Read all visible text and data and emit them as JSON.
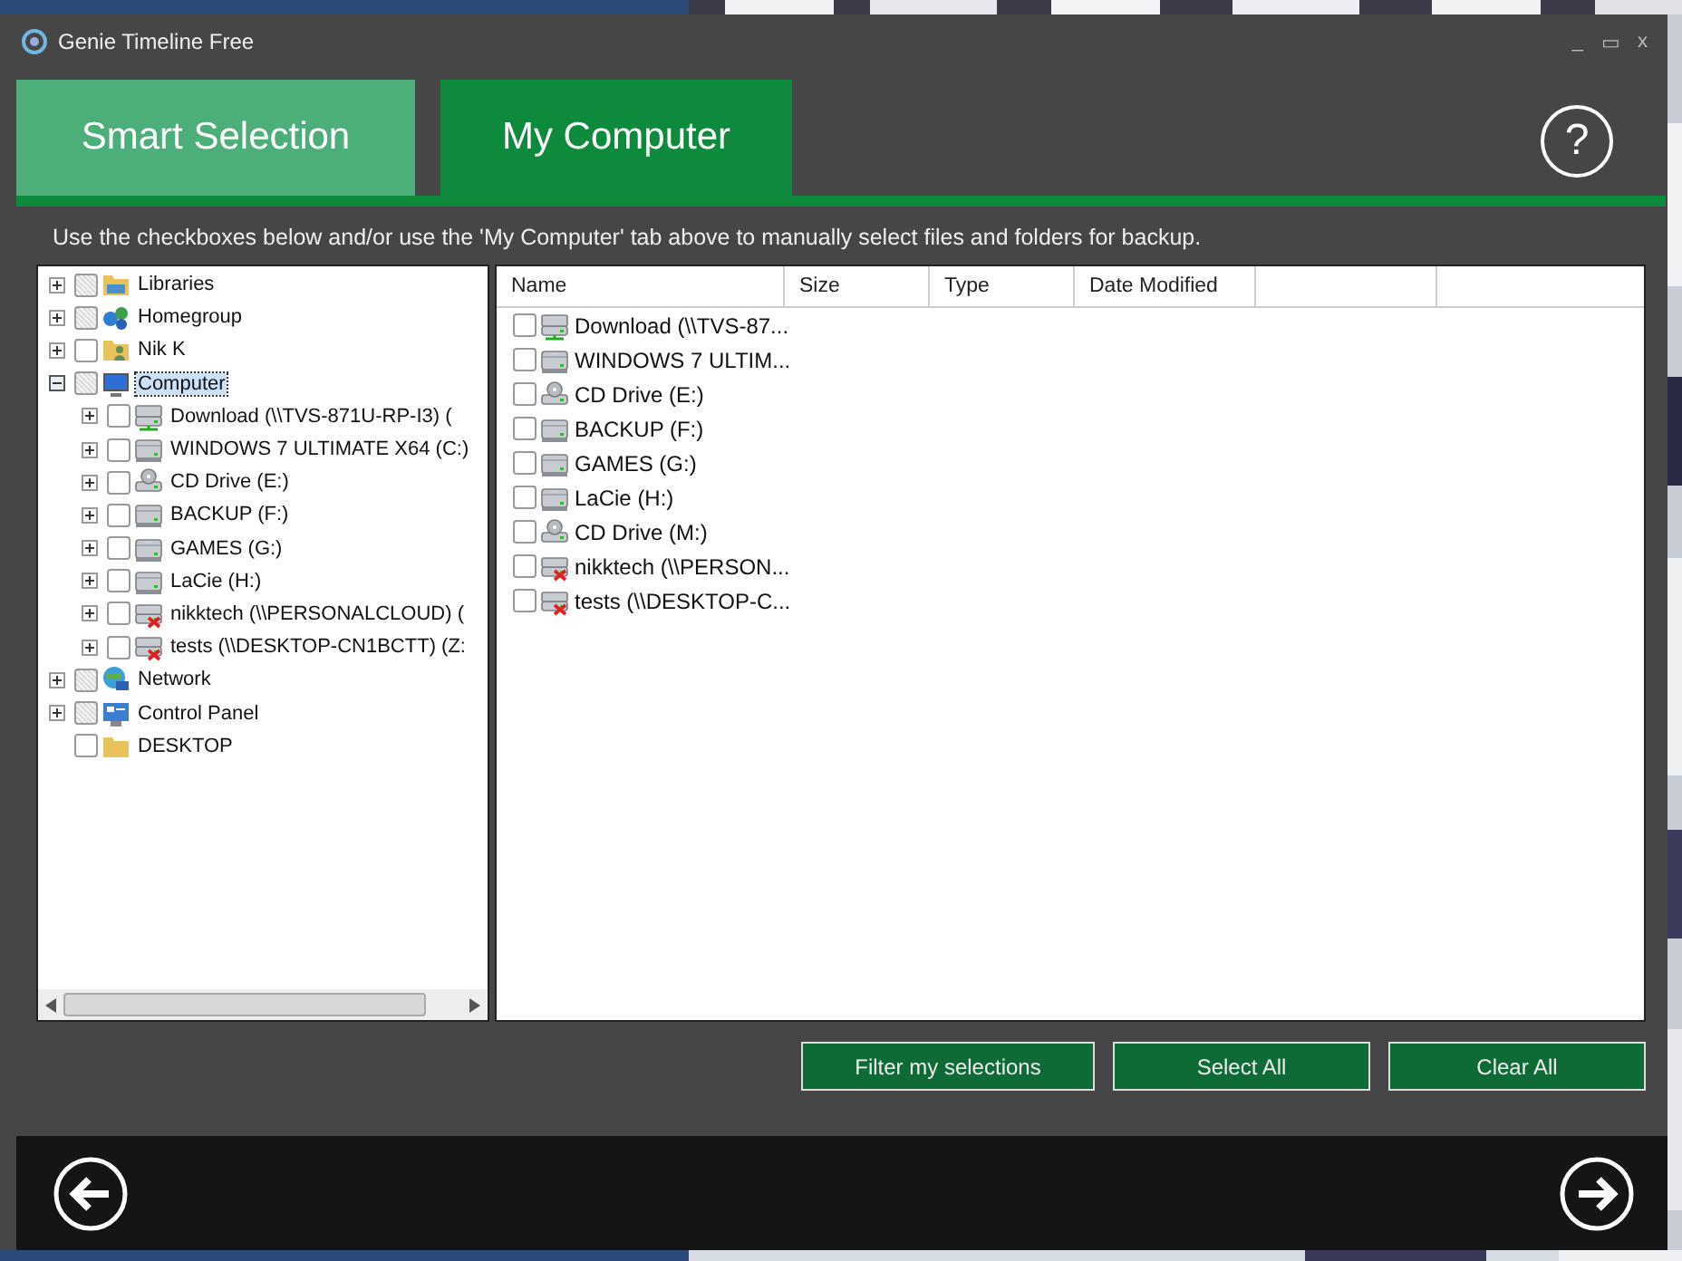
{
  "window": {
    "title": "Genie Timeline Free",
    "controls": [
      "_",
      "▭",
      "x"
    ]
  },
  "tabs": [
    {
      "label": "Smart Selection",
      "selected": false
    },
    {
      "label": "My Computer",
      "selected": true
    }
  ],
  "help": "?",
  "instruction": "Use the checkboxes below and/or use the 'My Computer' tab above to manually select files and folders for backup.",
  "tree": [
    {
      "label": "Libraries",
      "kind": "library",
      "checked": false,
      "disabled": true,
      "expanded": false,
      "selected": false
    },
    {
      "label": "Homegroup",
      "kind": "homegroup",
      "checked": false,
      "disabled": true,
      "expanded": false,
      "selected": false
    },
    {
      "label": "Nik K",
      "kind": "user",
      "checked": false,
      "disabled": false,
      "expanded": false,
      "selected": false
    },
    {
      "label": "Computer",
      "kind": "computer",
      "checked": false,
      "disabled": true,
      "expanded": true,
      "selected": true,
      "children": [
        {
          "label": "Download (\\\\TVS-871U-RP-I3) (",
          "kind": "netdrive",
          "checked": false,
          "disabled": false,
          "expanded": false,
          "selected": false
        },
        {
          "label": "WINDOWS 7 ULTIMATE X64 (C:)",
          "kind": "drive",
          "checked": false,
          "disabled": false,
          "expanded": false,
          "selected": false
        },
        {
          "label": "CD Drive (E:)",
          "kind": "cd",
          "checked": false,
          "disabled": false,
          "expanded": false,
          "selected": false
        },
        {
          "label": "BACKUP (F:)",
          "kind": "drive",
          "checked": false,
          "disabled": false,
          "expanded": false,
          "selected": false
        },
        {
          "label": "GAMES (G:)",
          "kind": "drive",
          "checked": false,
          "disabled": false,
          "expanded": false,
          "selected": false
        },
        {
          "label": "LaCie (H:)",
          "kind": "drive",
          "checked": false,
          "disabled": false,
          "expanded": false,
          "selected": false
        },
        {
          "label": "nikktech (\\\\PERSONALCLOUD) (",
          "kind": "offline",
          "checked": false,
          "disabled": false,
          "expanded": false,
          "selected": false
        },
        {
          "label": "tests (\\\\DESKTOP-CN1BCTT) (Z:",
          "kind": "offline",
          "checked": false,
          "disabled": false,
          "expanded": false,
          "selected": false
        }
      ]
    },
    {
      "label": "Network",
      "kind": "network",
      "checked": false,
      "disabled": true,
      "expanded": false,
      "selected": false
    },
    {
      "label": "Control Panel",
      "kind": "panel",
      "checked": false,
      "disabled": true,
      "expanded": false,
      "selected": false
    },
    {
      "label": "DESKTOP",
      "kind": "folder",
      "checked": false,
      "disabled": false,
      "selected": false
    }
  ],
  "list": {
    "columns": [
      "Name",
      "Size",
      "Type",
      "Date Modified"
    ],
    "rows": [
      {
        "name": "Download (\\\\TVS-87...",
        "kind": "netdrive",
        "checked": false
      },
      {
        "name": "WINDOWS 7 ULTIM...",
        "kind": "drive",
        "checked": false
      },
      {
        "name": "CD Drive (E:)",
        "kind": "cd",
        "checked": false
      },
      {
        "name": "BACKUP (F:)",
        "kind": "drive",
        "checked": false
      },
      {
        "name": "GAMES (G:)",
        "kind": "drive",
        "checked": false
      },
      {
        "name": "LaCie (H:)",
        "kind": "drive",
        "checked": false
      },
      {
        "name": "CD Drive (M:)",
        "kind": "cd",
        "checked": false
      },
      {
        "name": "nikktech (\\\\PERSON...",
        "kind": "offline",
        "checked": false
      },
      {
        "name": "tests (\\\\DESKTOP-C...",
        "kind": "offline",
        "checked": false
      }
    ]
  },
  "buttons": [
    "Filter my selections",
    "Select All",
    "Clear All"
  ]
}
